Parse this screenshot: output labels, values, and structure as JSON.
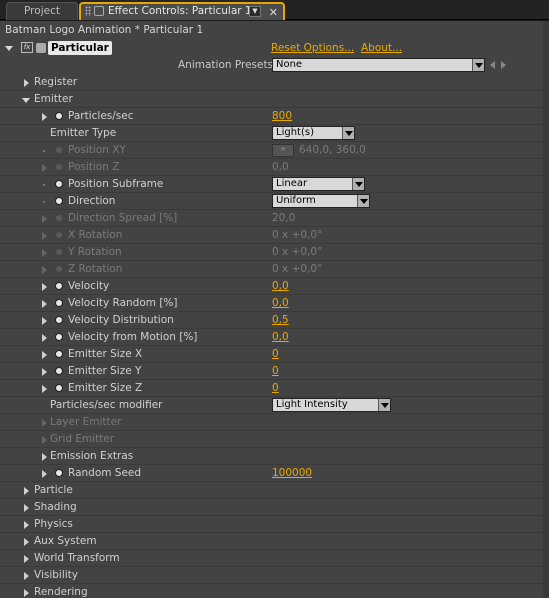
{
  "tabs": {
    "project": "Project",
    "effect_controls": "Effect Controls: Particular 1",
    "close_glyph": "✕",
    "menu_glyph": "▼"
  },
  "header": {
    "title": "Batman Logo Animation * Particular 1",
    "fx_badge": "fx",
    "effect_name": "Particular",
    "reset_link": "Reset Options...",
    "about_link": "About...",
    "presets_label": "Animation Presets:",
    "presets_value": "None"
  },
  "rows": {
    "register": "Register",
    "emitter": "Emitter",
    "particles_sec": {
      "label": "Particles/sec",
      "value": "800"
    },
    "emitter_type": {
      "label": "Emitter Type",
      "value": "Light(s)"
    },
    "position_xy": {
      "label": "Position XY",
      "value": "640,0, 360,0"
    },
    "position_z": {
      "label": "Position Z",
      "value": "0,0"
    },
    "position_subframe": {
      "label": "Position Subframe",
      "value": "Linear"
    },
    "direction": {
      "label": "Direction",
      "value": "Uniform"
    },
    "direction_spread": {
      "label": "Direction Spread [%]",
      "value": "20,0"
    },
    "x_rotation": {
      "label": "X Rotation",
      "value": "0 x +0,0°"
    },
    "y_rotation": {
      "label": "Y Rotation",
      "value": "0 x +0,0°"
    },
    "z_rotation": {
      "label": "Z Rotation",
      "value": "0 x +0,0°"
    },
    "velocity": {
      "label": "Velocity",
      "value": "0,0"
    },
    "velocity_random": {
      "label": "Velocity Random [%]",
      "value": "0,0"
    },
    "velocity_distribution": {
      "label": "Velocity Distribution",
      "value": "0,5"
    },
    "velocity_from_motion": {
      "label": "Velocity from Motion [%]",
      "value": "0,0"
    },
    "emitter_size_x": {
      "label": "Emitter Size X",
      "value": "0"
    },
    "emitter_size_y": {
      "label": "Emitter Size Y",
      "value": "0"
    },
    "emitter_size_z": {
      "label": "Emitter Size Z",
      "value": "0"
    },
    "particles_sec_modifier": {
      "label": "Particles/sec modifier",
      "value": "Light Intensity"
    },
    "layer_emitter": "Layer Emitter",
    "grid_emitter": "Grid Emitter",
    "emission_extras": "Emission Extras",
    "random_seed": {
      "label": "Random Seed",
      "value": "100000"
    },
    "particle": "Particle",
    "shading": "Shading",
    "physics": "Physics",
    "aux_system": "Aux System",
    "world_transform": "World Transform",
    "visibility": "Visibility",
    "rendering": "Rendering"
  },
  "colors": {
    "accent": "#e8a800",
    "panel_bg": "#434343",
    "disabled_text": "#7a7a7a"
  }
}
